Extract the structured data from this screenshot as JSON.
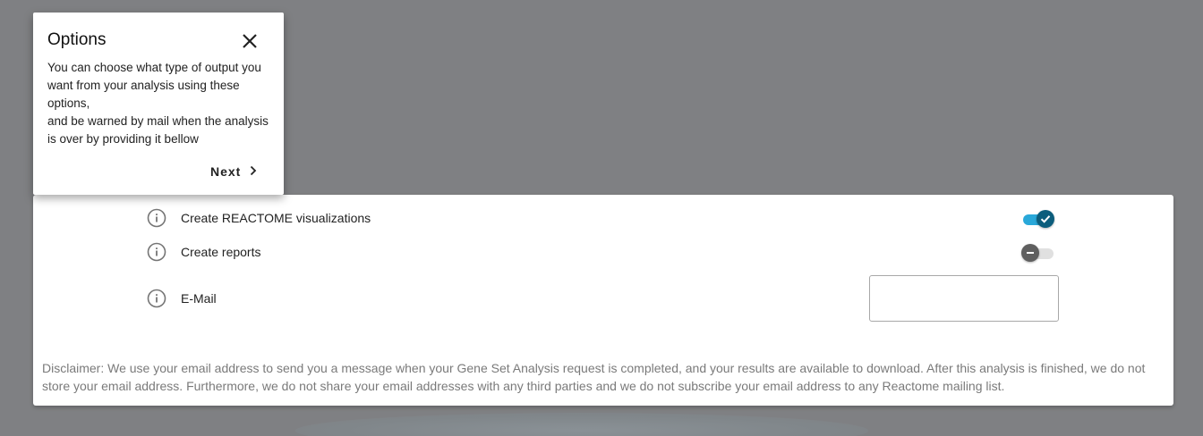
{
  "popover": {
    "title": "Options",
    "body": "You can choose what type of output you want from your analysis using these options,\nand be warned by mail when the analysis is over by providing it bellow",
    "next_label": "Next"
  },
  "options": [
    {
      "label": "Create REACTOME visualizations",
      "enabled": true
    },
    {
      "label": "Create reports",
      "enabled": false
    }
  ],
  "email": {
    "label": "E-Mail",
    "value": "",
    "placeholder": ""
  },
  "disclaimer": "Disclaimer: We use your email address to send you a message when your Gene Set Analysis request is completed, and your results are available to download. After this analysis is finished, we do not store your email address. Furthermore, we do not share your email addresses with any third parties and we do not subscribe your email address to any Reactome mailing list.",
  "colors": {
    "overlay": "#7f8083",
    "toggle_on_track": "#29a8d9",
    "toggle_on_knob": "#0c5d7c",
    "toggle_off_knob": "#5f5f5f"
  },
  "icons": {
    "info": "info-circle-icon",
    "close": "close-icon",
    "next": "chevron-right-icon",
    "check": "check-icon",
    "minus": "minus-icon"
  }
}
